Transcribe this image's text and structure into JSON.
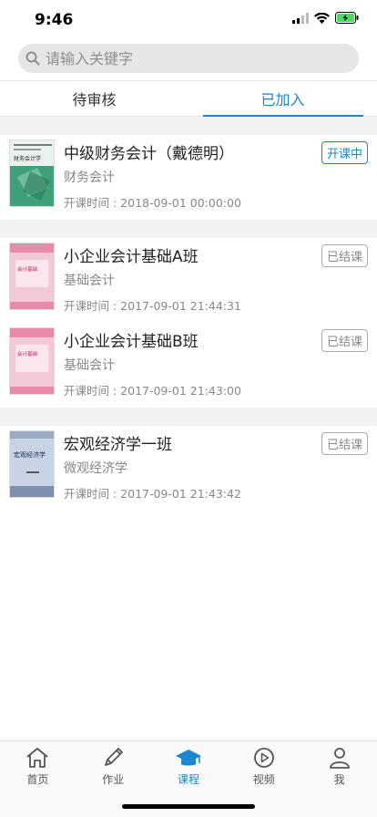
{
  "status": {
    "time": "9:46"
  },
  "search": {
    "placeholder": "请输入关键字"
  },
  "tabs": [
    {
      "label": "待审核",
      "active": false
    },
    {
      "label": "已加入",
      "active": true
    }
  ],
  "courses": [
    {
      "title": "中级财务会计（戴德明）",
      "subtitle": "财务会计",
      "time": "开课时间 : 2018-09-01 00:00:00",
      "status": "开课中",
      "cover_text": "财务会计学"
    },
    {
      "title": "小企业会计基础A班",
      "subtitle": "基础会计",
      "time": "开课时间 : 2017-09-01 21:44:31",
      "status": "已结课",
      "cover_text": "会计基础"
    },
    {
      "title": "小企业会计基础B班",
      "subtitle": "基础会计",
      "time": "开课时间 : 2017-09-01 21:43:00",
      "status": "已结课",
      "cover_text": "会计基础"
    },
    {
      "title": "宏观经济学一班",
      "subtitle": "微观经济学",
      "time": "开课时间 : 2017-09-01 21:43:42",
      "status": "已结课",
      "cover_text": "宏观经济学"
    }
  ],
  "tabbar": [
    {
      "label": "首页",
      "icon": "home-icon",
      "active": false
    },
    {
      "label": "作业",
      "icon": "pencil-icon",
      "active": false
    },
    {
      "label": "课程",
      "icon": "graduation-cap-icon",
      "active": true
    },
    {
      "label": "视频",
      "icon": "play-circle-icon",
      "active": false
    },
    {
      "label": "我",
      "icon": "user-icon",
      "active": false
    }
  ],
  "colors": {
    "accent": "#1a86d0",
    "divider": "#f2f2f2"
  }
}
